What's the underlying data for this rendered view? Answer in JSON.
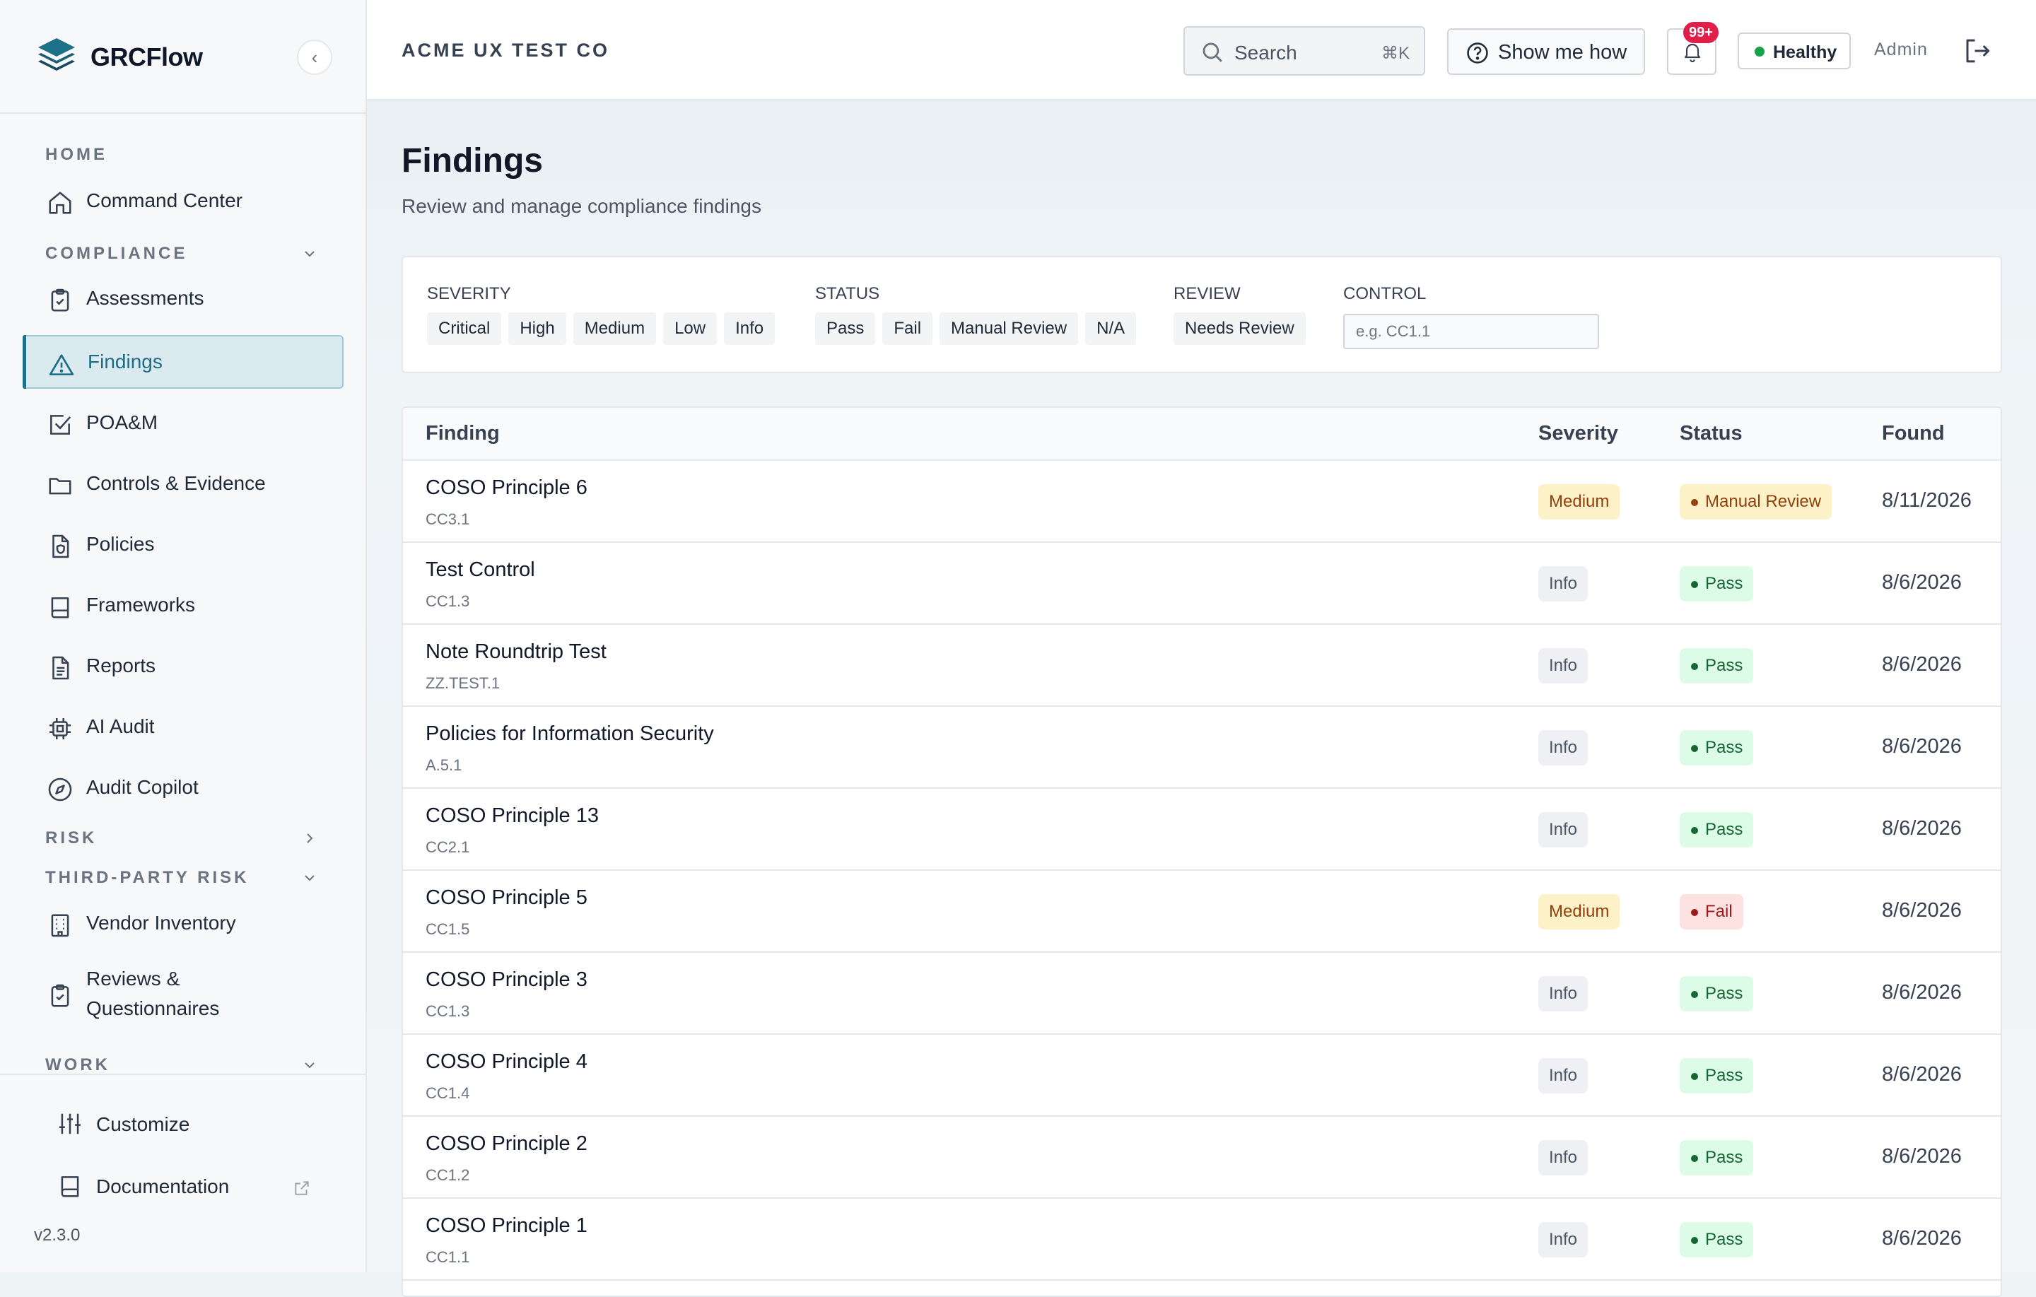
{
  "brand": {
    "name": "GRCFlow",
    "collapse_glyph": "‹"
  },
  "sidebar": {
    "sections": {
      "home": "HOME",
      "compliance": "COMPLIANCE",
      "risk": "RISK",
      "third_party": "THIRD-PARTY RISK",
      "work": "WORK"
    },
    "items": {
      "command_center": "Command Center",
      "assessments": "Assessments",
      "findings": "Findings",
      "poam": "POA&M",
      "controls": "Controls & Evidence",
      "policies": "Policies",
      "frameworks": "Frameworks",
      "reports": "Reports",
      "ai_audit": "AI Audit",
      "audit_copilot": "Audit Copilot",
      "vendor_inventory": "Vendor Inventory",
      "reviews_line1": "Reviews &",
      "reviews_line2": "Questionnaires"
    },
    "active": "findings",
    "footer": {
      "customize": "Customize",
      "documentation": "Documentation",
      "version": "v2.3.0"
    }
  },
  "topbar": {
    "org_name": "ACME UX TEST CO",
    "search_placeholder": "Search",
    "search_shortcut": "⌘K",
    "help_label": "Show me how",
    "notifications_badge": "99+",
    "health_label": "Healthy",
    "user_role": "Admin"
  },
  "page": {
    "title": "Findings",
    "subtitle": "Review and manage compliance findings"
  },
  "filters": {
    "severity": {
      "label": "SEVERITY",
      "options": [
        "Critical",
        "High",
        "Medium",
        "Low",
        "Info"
      ]
    },
    "status": {
      "label": "STATUS",
      "options": [
        "Pass",
        "Fail",
        "Manual Review",
        "N/A"
      ]
    },
    "review": {
      "label": "REVIEW",
      "options": [
        "Needs Review"
      ]
    },
    "control": {
      "label": "CONTROL",
      "placeholder": "e.g. CC1.1"
    }
  },
  "table": {
    "columns": [
      "Finding",
      "Severity",
      "Status",
      "Found"
    ],
    "rows": [
      {
        "name": "COSO Principle 6",
        "control": "CC3.1",
        "severity": "Medium",
        "status": "Manual Review",
        "found": "8/11/2026"
      },
      {
        "name": "Test Control",
        "control": "CC1.3",
        "severity": "Info",
        "status": "Pass",
        "found": "8/6/2026"
      },
      {
        "name": "Note Roundtrip Test",
        "control": "ZZ.TEST.1",
        "severity": "Info",
        "status": "Pass",
        "found": "8/6/2026"
      },
      {
        "name": "Policies for Information Security",
        "control": "A.5.1",
        "severity": "Info",
        "status": "Pass",
        "found": "8/6/2026"
      },
      {
        "name": "COSO Principle 13",
        "control": "CC2.1",
        "severity": "Info",
        "status": "Pass",
        "found": "8/6/2026"
      },
      {
        "name": "COSO Principle 5",
        "control": "CC1.5",
        "severity": "Medium",
        "status": "Fail",
        "found": "8/6/2026"
      },
      {
        "name": "COSO Principle 3",
        "control": "CC1.3",
        "severity": "Info",
        "status": "Pass",
        "found": "8/6/2026"
      },
      {
        "name": "COSO Principle 4",
        "control": "CC1.4",
        "severity": "Info",
        "status": "Pass",
        "found": "8/6/2026"
      },
      {
        "name": "COSO Principle 2",
        "control": "CC1.2",
        "severity": "Info",
        "status": "Pass",
        "found": "8/6/2026"
      },
      {
        "name": "COSO Principle 1",
        "control": "CC1.1",
        "severity": "Info",
        "status": "Pass",
        "found": "8/6/2026"
      }
    ]
  },
  "colors": {
    "accent": "#1c7088",
    "status_pass": "#166534",
    "status_fail": "#991b1b",
    "status_manual": "#92400e",
    "notification_badge": "#e11d48",
    "health_dot": "#16a34a"
  },
  "icons": {
    "logo": "stacked-layers-icon",
    "command_center": "home-icon",
    "assessments": "clipboard-check-icon",
    "findings": "warning-triangle-icon",
    "poam": "checkbox-icon",
    "controls": "folder-icon",
    "policies": "file-shield-icon",
    "frameworks": "book-icon",
    "reports": "file-text-icon",
    "ai_audit": "cpu-icon",
    "audit_copilot": "compass-icon",
    "vendor_inventory": "building-icon",
    "reviews": "clipboard-check-icon",
    "customize": "sliders-icon",
    "documentation": "book-icon",
    "search": "search-icon",
    "help": "question-circle-icon",
    "notifications": "bell-icon",
    "logout": "logout-icon"
  }
}
